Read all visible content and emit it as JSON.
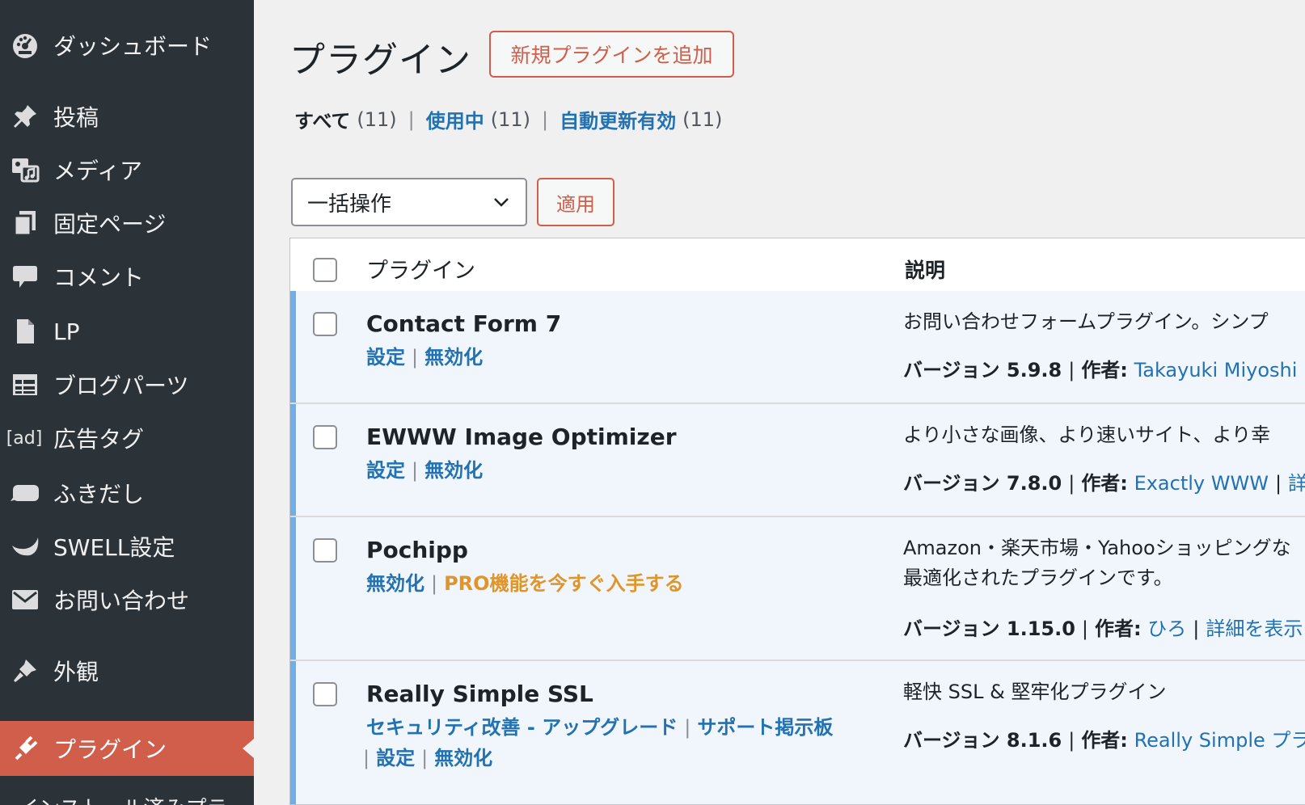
{
  "sidebar": {
    "items": [
      {
        "label": "ダッシュボード",
        "icon": "dashboard-icon"
      },
      {
        "label": "投稿",
        "icon": "pin-icon"
      },
      {
        "label": "メディア",
        "icon": "media-icon"
      },
      {
        "label": "固定ページ",
        "icon": "pages-icon"
      },
      {
        "label": "コメント",
        "icon": "comment-icon"
      },
      {
        "label": "LP",
        "icon": "document-icon"
      },
      {
        "label": "ブログパーツ",
        "icon": "table-icon"
      },
      {
        "label": "広告タグ",
        "icon": "ad-icon",
        "icon_text": "[ad]"
      },
      {
        "label": "ふきだし",
        "icon": "balloon-icon"
      },
      {
        "label": "SWELL設定",
        "icon": "swell-icon"
      },
      {
        "label": "お問い合わせ",
        "icon": "mail-icon"
      },
      {
        "label": "外観",
        "icon": "brush-icon"
      },
      {
        "label": "プラグイン",
        "icon": "plugin-icon",
        "active": true
      }
    ],
    "submenu_partial": "インストール済みプラ"
  },
  "header": {
    "title": "プラグイン",
    "add_new_label": "新規プラグインを追加"
  },
  "filters": {
    "all_label": "すべて",
    "all_count": "(11)",
    "active_label": "使用中",
    "active_count": "(11)",
    "autoupdate_label": "自動更新有効",
    "autoupdate_count": "(11)",
    "separator": "|"
  },
  "bulk": {
    "select_value": "一括操作",
    "apply_label": "適用"
  },
  "table": {
    "col_plugin": "プラグイン",
    "col_description": "説明",
    "rows": [
      {
        "name": "Contact Form 7",
        "actions": [
          "設定",
          "無効化"
        ],
        "desc": "お問い合わせフォームプラグイン。シンプ",
        "version": "バージョン 5.9.8",
        "author_label": "作者:",
        "author": "Takayuki Miyoshi"
      },
      {
        "name": "EWWW Image Optimizer",
        "actions": [
          "設定",
          "無効化"
        ],
        "desc": "より小さな画像、より速いサイト、より幸",
        "version": "バージョン 7.8.0",
        "author_label": "作者:",
        "author": "Exactly WWW",
        "details": "詳"
      },
      {
        "name": "Pochipp",
        "actions": [
          "無効化",
          "PRO機能を今すぐ入手する"
        ],
        "desc": "Amazon・楽天市場・Yahooショッピングな",
        "desc2": "最適化されたプラグインです。",
        "version": "バージョン 1.15.0",
        "author_label": "作者:",
        "author": "ひろ",
        "details": "詳細を表示"
      },
      {
        "name": "Really Simple SSL",
        "actions": [
          "セキュリティ改善 - アップグレード",
          "サポート掲示板",
          "設定",
          "無効化"
        ],
        "desc": "軽快 SSL & 堅牢化プラグイン",
        "version": "バージョン 8.1.6",
        "author_label": "作者:",
        "author": "Really Simple プラ"
      }
    ]
  },
  "colors": {
    "sidebar_bg": "#2c3338",
    "active_menu": "#d05e4a",
    "link": "#2271b1",
    "pro_link": "#e0952a",
    "active_row_bg": "#f0f6fc",
    "active_row_border": "#72aee6"
  }
}
